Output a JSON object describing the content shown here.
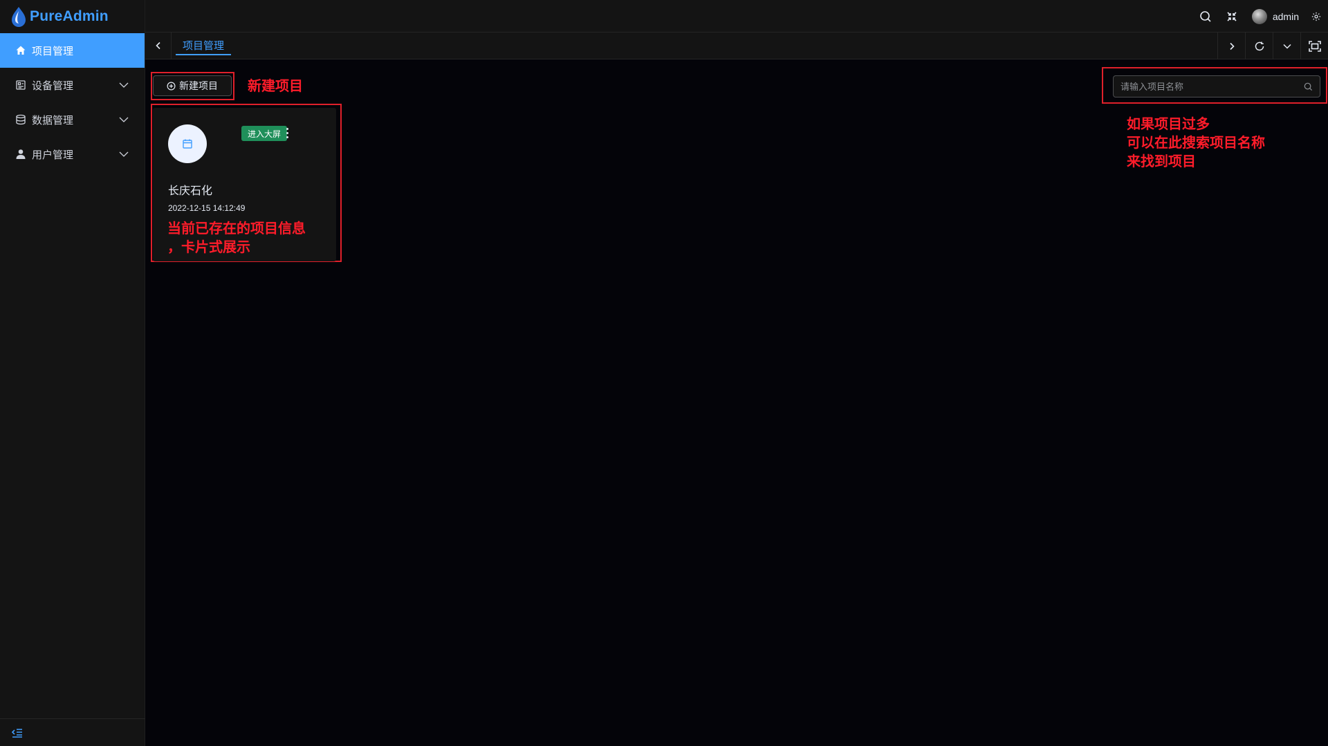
{
  "app": {
    "name": "PureAdmin"
  },
  "sidebar": {
    "items": [
      {
        "label": "项目管理",
        "icon": "home-icon",
        "active": true
      },
      {
        "label": "设备管理",
        "icon": "device-icon",
        "active": false
      },
      {
        "label": "数据管理",
        "icon": "database-icon",
        "active": false
      },
      {
        "label": "用户管理",
        "icon": "user-icon",
        "active": false
      }
    ]
  },
  "navbar": {
    "username": "admin"
  },
  "tags": {
    "active_tag": "项目管理"
  },
  "toolbar": {
    "new_button_label": "新建项目",
    "search_placeholder": "请输入项目名称"
  },
  "annotations": {
    "new_project": "新建项目",
    "search_line1": "如果项目过多",
    "search_line2": "可以在此搜索项目名称",
    "search_line3": "来找到项目",
    "card_line1": "当前已存在的项目信息",
    "card_line2": "，卡片式展示"
  },
  "projects": [
    {
      "name": "长庆石化",
      "created_at": "2022-12-15 14:12:49",
      "badge": "进入大屏"
    }
  ],
  "colors": {
    "accent": "#409eff",
    "annotation": "#ff1c2a",
    "badge": "#1f8f5a"
  }
}
